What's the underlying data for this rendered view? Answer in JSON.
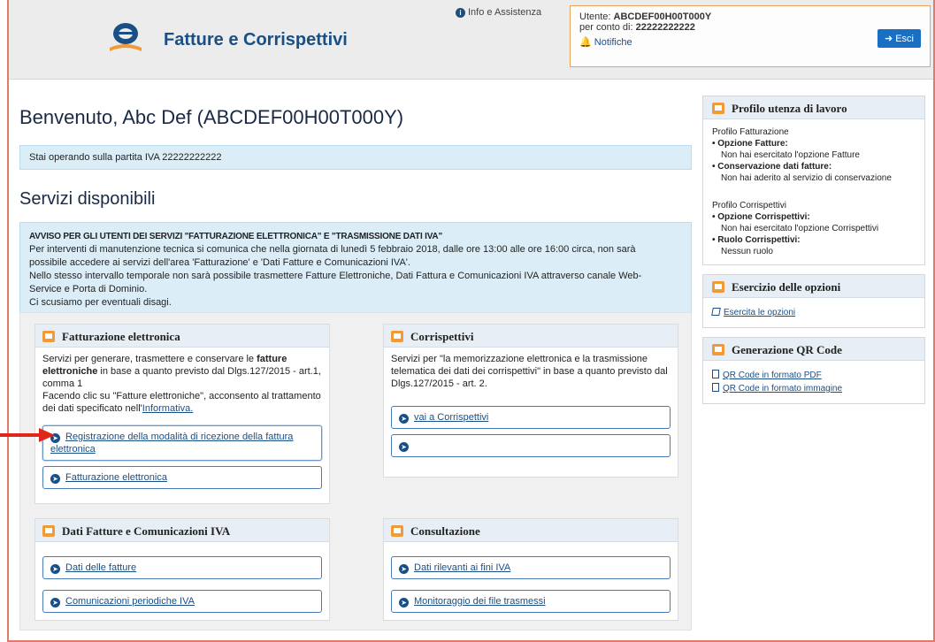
{
  "header": {
    "app_title": "Fatture e Corrispettivi",
    "info_label": "Info e Assistenza",
    "user_label": "Utente:",
    "user_value": "ABCDEF00H00T000Y",
    "behalf_label": "per conto di:",
    "behalf_value": "22222222222",
    "notifications_label": "Notifiche",
    "exit_label": "Esci"
  },
  "main": {
    "welcome": "Benvenuto, Abc Def (ABCDEF00H00T000Y)",
    "vat_banner": "Stai operando sulla partita IVA 22222222222",
    "services_title": "Servizi disponibili",
    "notice": {
      "title": "AVVISO PER GLI UTENTI DEI SERVIZI \"FATTURAZIONE ELETTRONICA\" E \"TRASMISSIONE DATI IVA\"",
      "line1": "Per interventi di manutenzione tecnica si comunica che nella giornata di lunedì 5 febbraio 2018, dalle ore 13:00 alle ore 16:00 circa, non sarà",
      "line2": "possibile accedere ai servizi dell'area 'Fatturazione' e 'Dati Fatture e Comunicazioni IVA'.",
      "line3": "Nello stesso intervallo temporale non sarà possibile trasmettere Fatture Elettroniche, Dati Fattura e Comunicazioni IVA attraverso canale Web-",
      "line4": "Service e Porta di Dominio.",
      "line5": "Ci scusiamo per eventuali disagi."
    }
  },
  "cards": {
    "fatturazione": {
      "title": "Fatturazione elettronica",
      "desc_a": "Servizi per generare, trasmettere e conservare le ",
      "desc_b": "fatture elettroniche",
      "desc_c": " in base a quanto previsto dal Dlgs.127/2015 - art.1, comma 1",
      "desc_d": "Facendo clic su \"Fatture elettroniche\", acconsento al trattamento dei dati specificato nell'",
      "desc_link": "Informativa.",
      "link1": "Registrazione della modalità di ricezione della fattura elettronica",
      "link2": "Fatturazione elettronica"
    },
    "corrispettivi": {
      "title": "Corrispettivi",
      "desc": "Servizi per \"la memorizzazione elettronica e la trasmissione telematica dei dati dei corrispettivi\" in base a quanto previsto dal Dlgs.127/2015 - art. 2.",
      "link1": "vai a Corrispettivi",
      "link2": ""
    },
    "dati": {
      "title": "Dati Fatture e Comunicazioni IVA",
      "link1": "Dati delle fatture",
      "link2": "Comunicazioni periodiche IVA"
    },
    "consultazione": {
      "title": "Consultazione",
      "link1": "Dati rilevanti ai fini IVA",
      "link2": "Monitoraggio dei file trasmessi"
    }
  },
  "sidebar": {
    "profilo": {
      "title": "Profilo utenza di lavoro",
      "fatt_heading": "Profilo Fatturazione",
      "opz_fatture_label": "Opzione Fatture:",
      "opz_fatture_value": "Non hai esercitato l'opzione Fatture",
      "conserv_label": "Conservazione dati fatture:",
      "conserv_value": "Non hai aderito al servizio di conservazione",
      "corr_heading": "Profilo Corrispettivi",
      "opz_corr_label": "Opzione Corrispettivi:",
      "opz_corr_value": "Non hai esercitato l'opzione Corrispettivi",
      "ruolo_label": "Ruolo Corrispettivi:",
      "ruolo_value": "Nessun ruolo"
    },
    "esercizio": {
      "title": "Esercizio delle opzioni",
      "link": "Esercita le opzioni"
    },
    "qr": {
      "title": "Generazione QR Code",
      "link_pdf": "QR Code in formato PDF",
      "link_img": "QR Code in formato immagine"
    }
  },
  "colors": {
    "brand_blue": "#1a4f86",
    "accent_orange": "#f19a36",
    "banner_bg": "#dbeef8",
    "alert_red": "#e0261b"
  }
}
